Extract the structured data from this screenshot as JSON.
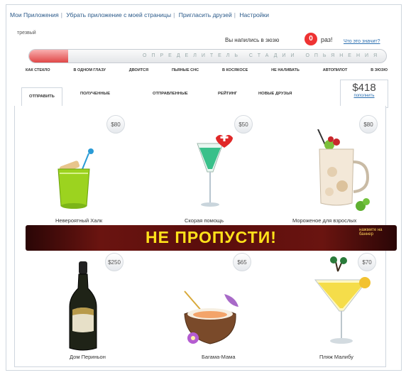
{
  "top_links": [
    "Мои Приложения",
    "Убрать приложение с моей страницы",
    "Пригласить друзей",
    "Настройки"
  ],
  "sobriety_label": "трезвый",
  "drunk_counter": {
    "prefix": "Вы напились в зюзю",
    "count": "0",
    "suffix": "раз!",
    "link": "Что это значит?"
  },
  "progress": {
    "label": "ОПРЕДЕЛИТЕЛЬ СТАДИИ ОПЬЯНЕНИЯ",
    "fill_fraction": 0.11
  },
  "stages": [
    "КАК СТЕКЛО",
    "В ОДНОМ ГЛАЗУ",
    "ДВОИТСЯ",
    "ПЬЯНЫЕ СНС",
    "В КОСЯКОСЕ",
    "НЕ НАЛИВАТЬ",
    "АВТОПИЛОТ",
    "В ЗЮЗЮ"
  ],
  "tabs": [
    "ОТПРАВИТЬ",
    "ПОЛУЧЕННЫЕ",
    "ОТПРАВЛЕННЫЕ",
    "РЕЙТИНГ",
    "НОВЫЕ ДРУЗЬЯ"
  ],
  "balance": {
    "amount": "$418",
    "link": "пополнить"
  },
  "drinks": [
    {
      "name": "Невероятный Халк",
      "price": "$80",
      "icon": "green-cocktail-icon"
    },
    {
      "name": "Скорая помощь",
      "price": "$50",
      "icon": "green-shot-glass-icon"
    },
    {
      "name": "Мороженое для взрослых",
      "price": "$80",
      "icon": "ice-cream-mug-icon"
    },
    {
      "name": "Дом Периньон",
      "price": "$250",
      "icon": "champagne-bottle-icon"
    },
    {
      "name": "Багама-Мама",
      "price": "$65",
      "icon": "coconut-cocktail-icon"
    },
    {
      "name": "Пляж Малибу",
      "price": "$70",
      "icon": "martini-glass-icon"
    }
  ],
  "banner": {
    "text": "НЕ ПРОПУСТИ!",
    "sub": "нажмите на баннер"
  },
  "colors": {
    "banner_text": "#ffe11a",
    "bar_fill": "#e04747",
    "link": "#2b6fb0"
  }
}
